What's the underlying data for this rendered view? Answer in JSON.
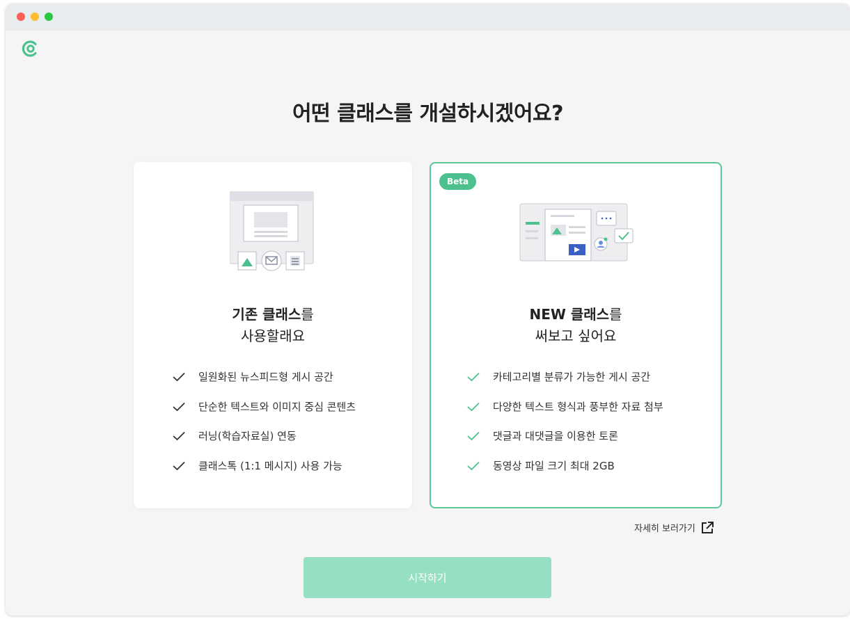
{
  "header": {
    "title": "어떤 클래스를 개설하시겠어요?"
  },
  "options": [
    {
      "heading_bold": "기존 클래스",
      "heading_rest": "를",
      "heading_line2": "사용할래요",
      "features": [
        "일원화된 뉴스피드형 게시 공간",
        "단순한 텍스트와 이미지 중심 콘텐츠",
        "러닝(학습자료실) 연동",
        "클래스톡 (1:1 메시지) 사용 가능"
      ],
      "check_color": "#333333"
    },
    {
      "badge": "Beta",
      "heading_bold": "NEW 클래스",
      "heading_rest": "를",
      "heading_line2": "써보고 싶어요",
      "features": [
        "카테고리별 분류가 가능한 게시 공간",
        "다양한 텍스트 형식과 풍부한 자료 첨부",
        "댓글과 대댓글을 이용한 토론",
        "동영상 파일 크기 최대 2GB"
      ],
      "check_color": "#4cc08d",
      "selected": true
    }
  ],
  "detail_link": {
    "label": "자세히 보러가기",
    "icon": "external-link-icon"
  },
  "start_button": {
    "label": "시작하기"
  },
  "colors": {
    "accent": "#4cc08d",
    "button_disabled": "#95dfc2",
    "selected_border": "#5cc89a"
  }
}
